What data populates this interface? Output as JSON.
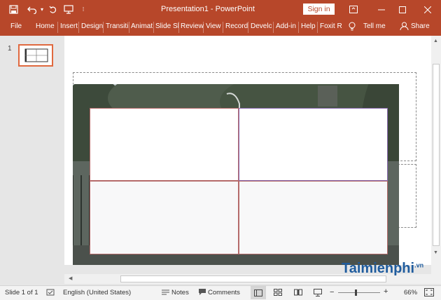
{
  "window": {
    "title": "Presentation1  -  PowerPoint",
    "sign_in_label": "Sign in"
  },
  "qat": {
    "save_icon": "save-icon",
    "undo_icon": "undo-icon",
    "redo_icon": "redo-icon",
    "customize_icon": "customize-icon"
  },
  "ribbon": {
    "tabs": [
      "File",
      "Home",
      "Insert",
      "Design",
      "Transiti",
      "Animat",
      "Slide Sh",
      "Review",
      "View",
      "Record",
      "Develo",
      "Add-in",
      "Help",
      "Foxit Re"
    ],
    "tell_me": "Tell me",
    "share": "Share"
  },
  "thumbnails": [
    {
      "number": "1"
    }
  ],
  "status": {
    "slide_info": "Slide 1 of 1",
    "language": "English (United States)",
    "notes": "Notes",
    "comments": "Comments",
    "zoom": "66%"
  },
  "watermark": {
    "text": "Taimienphi",
    "suffix": ".vn"
  },
  "colors": {
    "accent": "#b7472a",
    "status_bg": "#f3f3f3"
  }
}
